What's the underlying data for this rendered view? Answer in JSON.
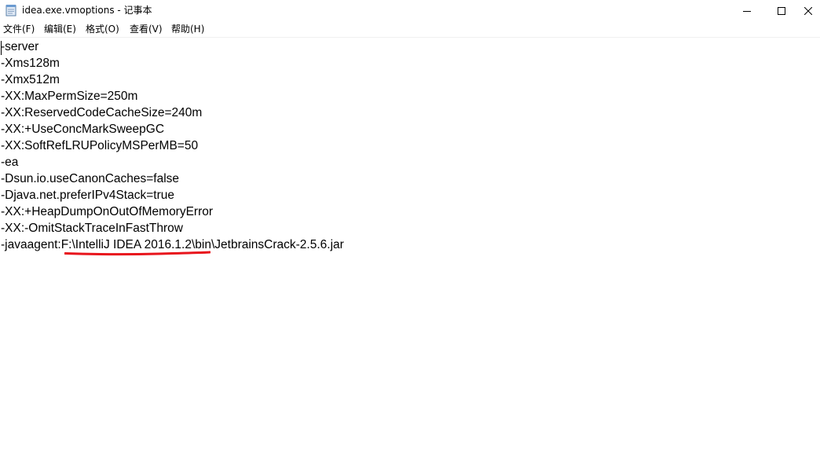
{
  "window": {
    "title": "idea.exe.vmoptions - 记事本"
  },
  "menu": {
    "file": "文件(F)",
    "edit": "编辑(E)",
    "format": "格式(O)",
    "view": "查看(V)",
    "help": "帮助(H)"
  },
  "editor": {
    "lines": [
      "-server",
      "-Xms128m",
      "-Xmx512m",
      "-XX:MaxPermSize=250m",
      "-XX:ReservedCodeCacheSize=240m",
      "-XX:+UseConcMarkSweepGC",
      "-XX:SoftRefLRUPolicyMSPerMB=50",
      "-ea",
      "-Dsun.io.useCanonCaches=false",
      "-Djava.net.preferIPv4Stack=true",
      "-XX:+HeapDumpOnOutOfMemoryError",
      "-XX:-OmitStackTraceInFastThrow",
      "-javaagent:F:\\IntelliJ IDEA 2016.1.2\\bin\\JetbrainsCrack-2.5.6.jar"
    ]
  },
  "colors": {
    "annotation": "#e8141c",
    "text": "#000000",
    "background": "#ffffff"
  }
}
